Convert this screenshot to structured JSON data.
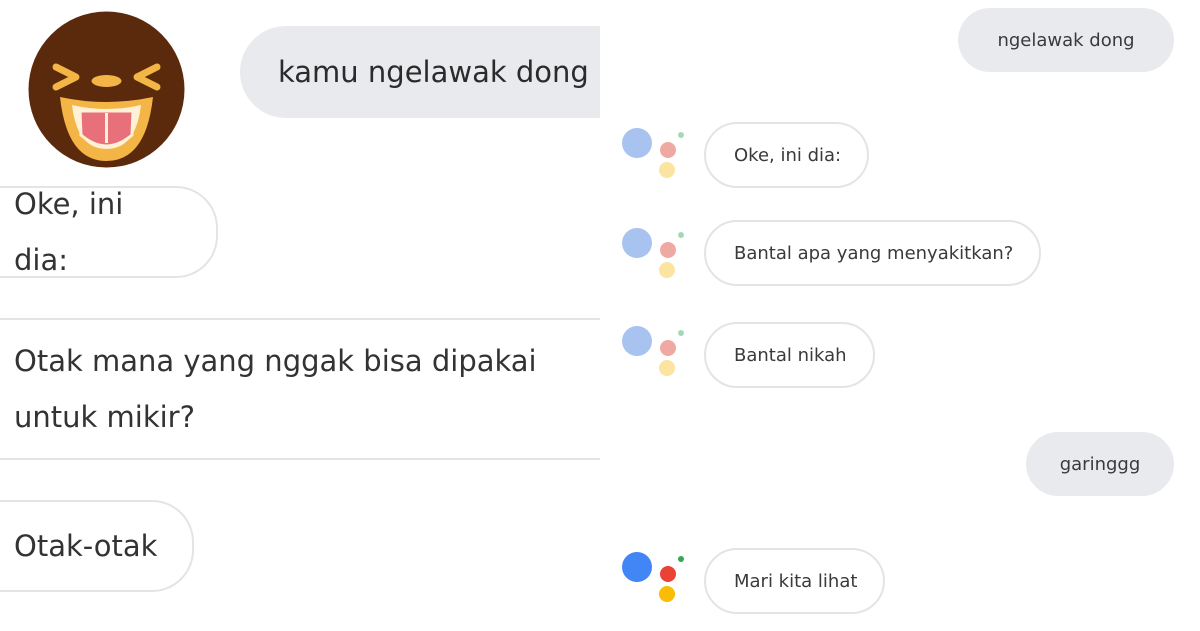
{
  "left_panel": {
    "user_message": "kamu ngelawak dong",
    "assistant_messages": [
      "Oke, ini dia:",
      "Otak mana yang nggak bisa dipakai untuk mikir?",
      "Otak-otak"
    ],
    "avatar_icon": "laughing-face-icon",
    "avatar_colors": {
      "face": "#5b2a0c",
      "tongue": "#e7707a",
      "features": "#f3b545"
    }
  },
  "right_panel": {
    "user_messages": [
      "ngelawak dong",
      "garinggg"
    ],
    "assistant_messages": [
      "Oke, ini dia:",
      "Bantal apa yang menyakitkan?",
      "Bantal nikah",
      "Mari kita lihat"
    ],
    "assistant_icon": "google-assistant-icon",
    "brand_colors": {
      "blue": "#4285f4",
      "red": "#ea4335",
      "yellow": "#fbbc05",
      "green": "#34a853"
    }
  }
}
